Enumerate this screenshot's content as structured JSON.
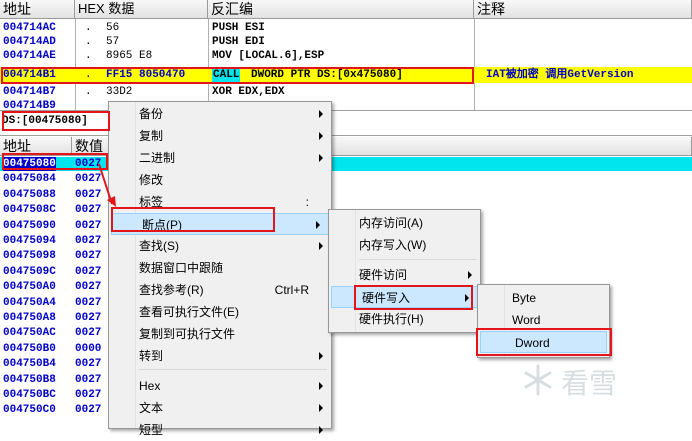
{
  "cpu": {
    "headers": [
      "地址",
      "HEX 数据",
      "反汇编",
      "注释"
    ],
    "rows": [
      {
        "addr": "004714AC",
        "dot": ".",
        "hex": "56",
        "dis": "PUSH ESI",
        "comment": ""
      },
      {
        "addr": "004714AD",
        "dot": ".",
        "hex": "57",
        "dis": "PUSH EDI",
        "comment": ""
      },
      {
        "addr": "004714AE",
        "dot": ".",
        "hex": "8965 E8",
        "dis": "MOV [LOCAL.6],ESP",
        "comment": ""
      },
      {
        "addr": "004714B1",
        "dot": ".",
        "hex": "FF15 8050470",
        "dis_call": "CALL",
        "dis": "DWORD PTR DS:[0x475080]",
        "comment": "IAT被加密 调用GetVersion"
      },
      {
        "addr": "004714B7",
        "dot": ".",
        "hex": "33D2",
        "dis": "XOR EDX,EDX",
        "comment": ""
      },
      {
        "addr": "004714B9",
        "dot": "",
        "hex": "",
        "dis": "",
        "comment": ""
      }
    ]
  },
  "info": {
    "text": "DS:[00475080]"
  },
  "dump": {
    "headers": [
      "地址",
      "数值"
    ],
    "rows": [
      {
        "addr": "00475080",
        "val": "0027"
      },
      {
        "addr": "00475084",
        "val": "0027"
      },
      {
        "addr": "00475088",
        "val": "0027"
      },
      {
        "addr": "0047508C",
        "val": "0027"
      },
      {
        "addr": "00475090",
        "val": "0027"
      },
      {
        "addr": "00475094",
        "val": "0027"
      },
      {
        "addr": "00475098",
        "val": "0027"
      },
      {
        "addr": "0047509C",
        "val": "0027"
      },
      {
        "addr": "004750A0",
        "val": "0027"
      },
      {
        "addr": "004750A4",
        "val": "0027"
      },
      {
        "addr": "004750A8",
        "val": "0027"
      },
      {
        "addr": "004750AC",
        "val": "0027"
      },
      {
        "addr": "004750B0",
        "val": "0000"
      },
      {
        "addr": "004750B4",
        "val": "0027"
      },
      {
        "addr": "004750B8",
        "val": "0027"
      },
      {
        "addr": "004750BC",
        "val": "0027"
      },
      {
        "addr": "004750C0",
        "val": "0027"
      }
    ]
  },
  "context_menu": {
    "items": [
      {
        "label": "备份",
        "submenu": true
      },
      {
        "label": "复制",
        "submenu": true
      },
      {
        "label": "二进制",
        "submenu": true
      },
      {
        "label": "修改",
        "submenu": false
      },
      {
        "label": "标签",
        "shortcut": ":",
        "submenu": false
      },
      {
        "label": "断点(P)",
        "submenu": true
      },
      {
        "label": "查找(S)",
        "submenu": true
      },
      {
        "label": "数据窗口中跟随",
        "submenu": false
      },
      {
        "label": "查找参考(R)",
        "shortcut": "Ctrl+R",
        "submenu": false
      },
      {
        "label": "查看可执行文件(E)",
        "submenu": false
      },
      {
        "label": "复制到可执行文件",
        "submenu": false
      },
      {
        "label": "转到",
        "submenu": true
      },
      {
        "label": "Hex",
        "submenu": true
      },
      {
        "label": "文本",
        "submenu": true
      },
      {
        "label": "短型",
        "submenu": true
      }
    ]
  },
  "breakpoint_menu": {
    "items": [
      {
        "label": "内存访问(A)",
        "submenu": false
      },
      {
        "label": "内存写入(W)",
        "submenu": false
      },
      {
        "label": "硬件访问",
        "submenu": true
      },
      {
        "label": "硬件写入",
        "submenu": true
      },
      {
        "label": "硬件执行(H)",
        "submenu": false
      }
    ]
  },
  "size_menu": {
    "items": [
      {
        "label": "Byte"
      },
      {
        "label": "Word"
      },
      {
        "label": "Dword"
      }
    ]
  },
  "watermark": {
    "text": "看雪"
  },
  "colors": {
    "highlight_yellow": "#ffff00",
    "cursor_cyan": "#00e5ee",
    "annotation_red": "#e3151b",
    "address_blue": "#0000c8"
  }
}
